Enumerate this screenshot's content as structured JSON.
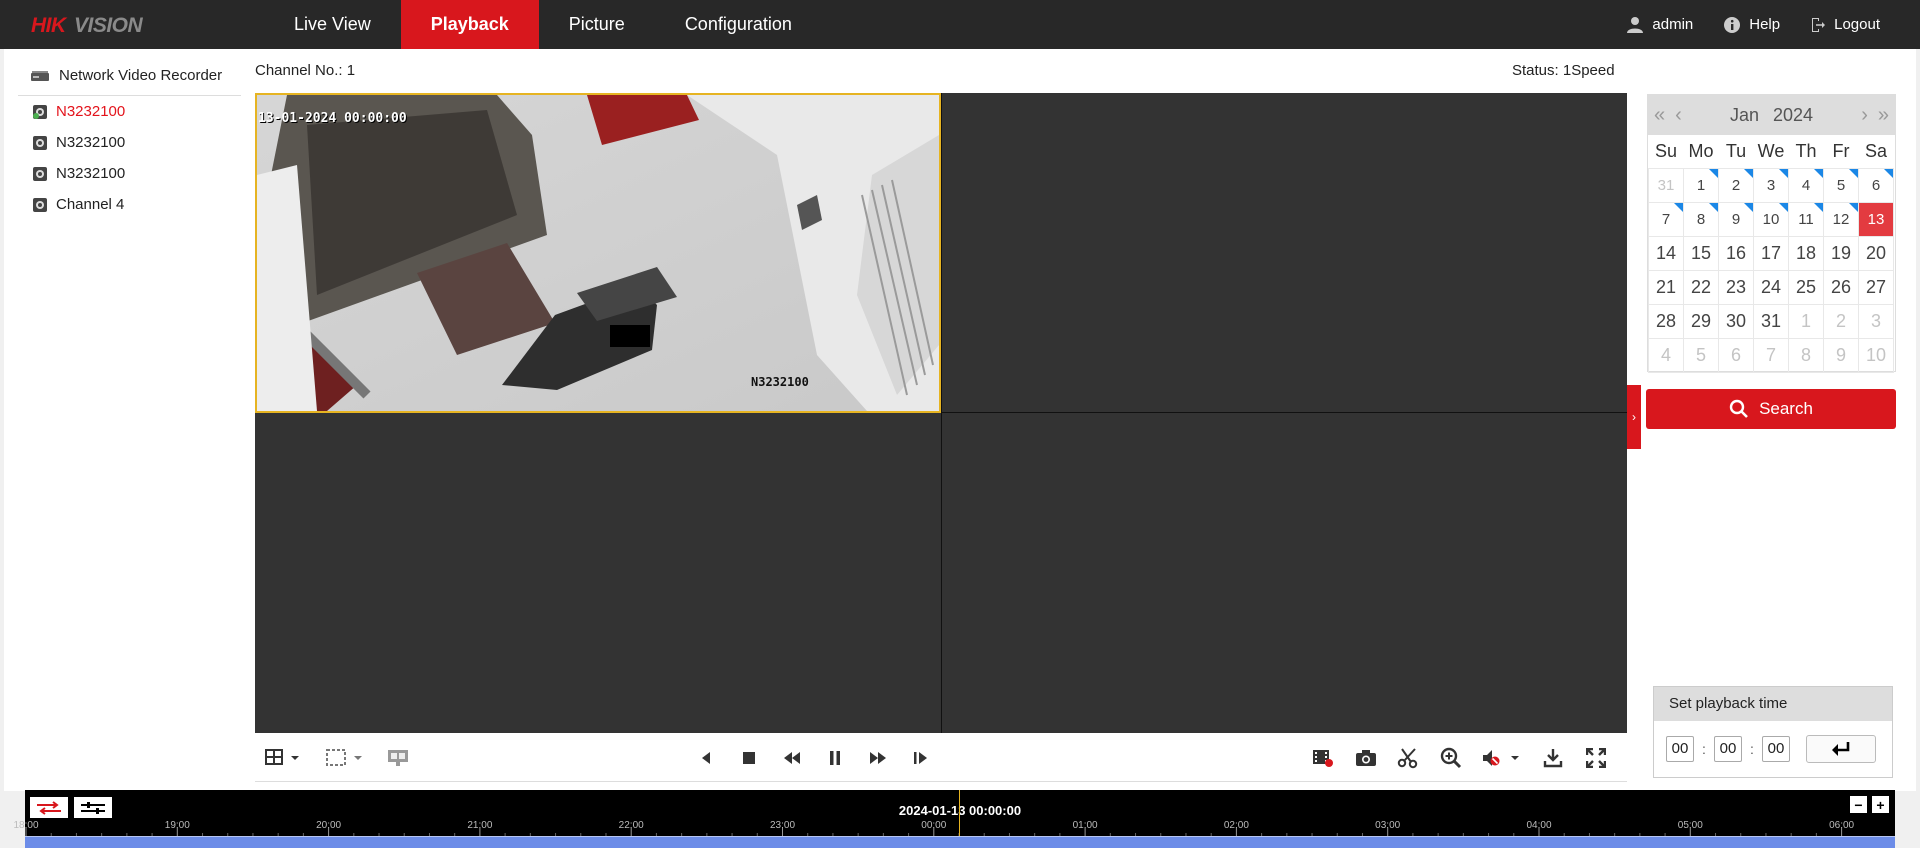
{
  "nav": {
    "brand": "HIKVISION",
    "items": [
      "Live View",
      "Playback",
      "Picture",
      "Configuration"
    ],
    "active": "Playback",
    "user": "admin",
    "help": "Help",
    "logout": "Logout"
  },
  "tree": {
    "root": "Network Video Recorder",
    "channels": [
      {
        "label": "N3232100",
        "active": true
      },
      {
        "label": "N3232100",
        "active": false
      },
      {
        "label": "N3232100",
        "active": false
      },
      {
        "label": "Channel 4",
        "active": false
      }
    ]
  },
  "player": {
    "channel_no": "Channel No.: 1",
    "status": "Status: 1Speed",
    "osd_time": "13-01-2024 00:00:00",
    "osd_name": "N3232100"
  },
  "calendar": {
    "month": "Jan",
    "year": "2024",
    "weekdays": [
      "Su",
      "Mo",
      "Tu",
      "We",
      "Th",
      "Fr",
      "Sa"
    ],
    "days": [
      [
        "31",
        "1",
        "2",
        "3",
        "4",
        "5",
        "6"
      ],
      [
        "7",
        "8",
        "9",
        "10",
        "11",
        "12",
        "13"
      ],
      [
        "14",
        "15",
        "16",
        "17",
        "18",
        "19",
        "20"
      ],
      [
        "21",
        "22",
        "23",
        "24",
        "25",
        "26",
        "27"
      ],
      [
        "28",
        "29",
        "30",
        "31",
        "1",
        "2",
        "3"
      ],
      [
        "4",
        "5",
        "6",
        "7",
        "8",
        "9",
        "10"
      ]
    ],
    "muted_prefix": 1,
    "muted_suffix": 10,
    "recorded_days": [
      1,
      2,
      3,
      4,
      5,
      6,
      7,
      8,
      9,
      10,
      11,
      12
    ],
    "selected_day": "13",
    "search_label": "Search"
  },
  "playback_time": {
    "title": "Set playback time",
    "hh": "00",
    "mm": "00",
    "ss": "00"
  },
  "timeline": {
    "current": "2024-01-13 00:00:00",
    "labels": [
      "18:00",
      "19:00",
      "20:00",
      "21:00",
      "22:00",
      "23:00",
      "00:00",
      "01:00",
      "02:00",
      "03:00",
      "04:00",
      "05:00",
      "06:00"
    ]
  },
  "colors": {
    "brand_red": "#d8171d",
    "record_blue": "#6c8ce8",
    "selection_yellow": "#e6b422"
  }
}
